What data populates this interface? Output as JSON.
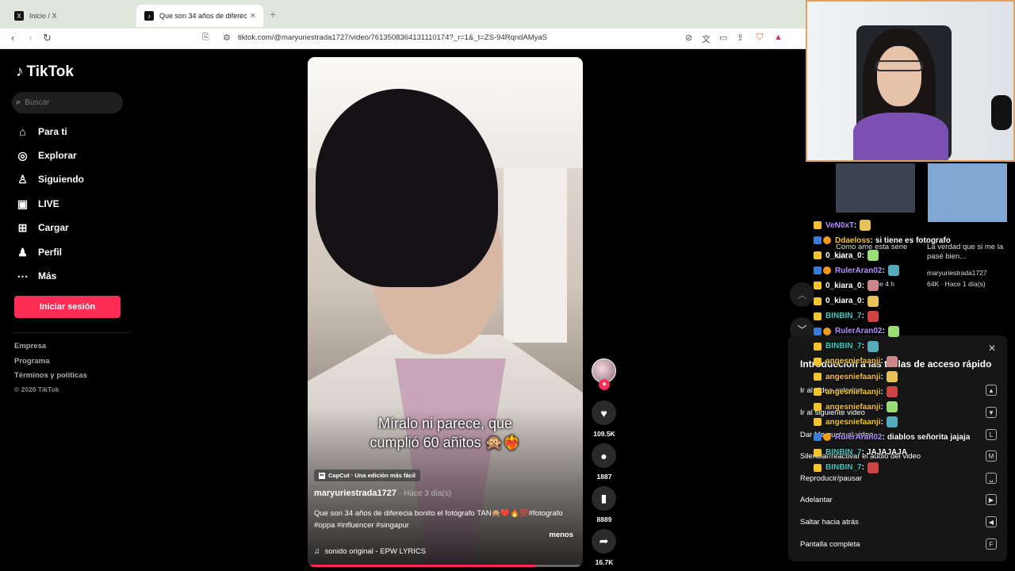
{
  "browser": {
    "tabs": [
      {
        "label": "Inicio / X",
        "favicon": "X"
      },
      {
        "label": "Que son 34 años de diferecia",
        "favicon": "♪",
        "active": true
      }
    ],
    "url": "tiktok.com/@maryuriestrada1727/video/7613508364131110174?_r=1&_t=ZS-94RqndAMyaS"
  },
  "sidebar": {
    "brand": "TikTok",
    "search_placeholder": "Buscar",
    "nav": [
      {
        "label": "Para ti",
        "icon": "home-icon"
      },
      {
        "label": "Explorar",
        "icon": "compass-icon"
      },
      {
        "label": "Siguiendo",
        "icon": "following-icon"
      },
      {
        "label": "LIVE",
        "icon": "live-icon"
      },
      {
        "label": "Cargar",
        "icon": "upload-icon"
      },
      {
        "label": "Perfil",
        "icon": "profile-icon"
      },
      {
        "label": "Más",
        "icon": "more-icon"
      }
    ],
    "login": "Iniciar sesión",
    "footer": [
      "Empresa",
      "Programa",
      "Términos y políticas"
    ],
    "copyright": "© 2026 TikTok"
  },
  "video": {
    "caption_line1": "Míralo ni parece, que",
    "caption_line2": "cumplió 60 añitos 🙊❤️‍🔥",
    "capcut_label": "CapCut · Una edición más fácil",
    "author": "maryuriestrada1727",
    "posted": "· Hace 3 día(s)",
    "description": "Que son 34 años de diferecia bonito el fotógrafo TAN🙊❤️🔥💯#fotografo #oppa #influencer #singapur",
    "less": "menos",
    "sound": "sonido original - EPW LYRICS",
    "progress": 0.83
  },
  "actions": {
    "likes": "109.5K",
    "comments": "1887",
    "saves": "8889",
    "shares": "16.7K"
  },
  "background_thumbs": {
    "left_text": "Como ame esta serie tan...",
    "left_time": "Hace 4 h",
    "right_text": "La verdad que si me la pasé bien...",
    "right_user": "maryuriestrada1727",
    "right_meta": "64K · Hace 1 día(s)"
  },
  "chat": [
    {
      "user": "VeN0xT",
      "msg": "",
      "color": "#b48cff",
      "badges": [
        "crown"
      ]
    },
    {
      "user": "Ddaeloss",
      "msg": "si tiene es fotografo",
      "color": "#f4c430",
      "badges": [
        "blue",
        "orange"
      ]
    },
    {
      "user": "0_kiara_0",
      "msg": "",
      "color": "#ffffff",
      "badges": [
        "crown"
      ]
    },
    {
      "user": "RulerAran02",
      "msg": "",
      "color": "#b48cff",
      "badges": [
        "blue",
        "orange"
      ]
    },
    {
      "user": "0_kiara_0",
      "msg": "",
      "color": "#ffffff",
      "badges": [
        "crown"
      ]
    },
    {
      "user": "0_kiara_0",
      "msg": "",
      "color": "#ffffff",
      "badges": [
        "crown"
      ]
    },
    {
      "user": "BINBIN_7",
      "msg": "",
      "color": "#3ec9c0",
      "badges": [
        "crown"
      ]
    },
    {
      "user": "RulerAran02",
      "msg": "",
      "color": "#b48cff",
      "badges": [
        "blue",
        "orange"
      ]
    },
    {
      "user": "BINBIN_7",
      "msg": "",
      "color": "#3ec9c0",
      "badges": [
        "crown"
      ]
    },
    {
      "user": "angesniefaanji",
      "msg": "",
      "color": "#f4c430",
      "badges": [
        "crown"
      ]
    },
    {
      "user": "angesniefaanji",
      "msg": "",
      "color": "#f4c430",
      "badges": [
        "crown"
      ]
    },
    {
      "user": "angesniefaanji",
      "msg": "",
      "color": "#f4c430",
      "badges": [
        "crown"
      ]
    },
    {
      "user": "angesniefaanji",
      "msg": "",
      "color": "#f4c430",
      "badges": [
        "crown"
      ]
    },
    {
      "user": "angesniefaanji",
      "msg": "",
      "color": "#f4c430",
      "badges": [
        "crown"
      ]
    },
    {
      "user": "RulerAran02",
      "msg": "diablos señorita jajaja",
      "color": "#b48cff",
      "badges": [
        "blue",
        "orange"
      ]
    },
    {
      "user": "BINBIN_7",
      "msg": "JAJAJAJA",
      "color": "#3ec9c0",
      "badges": [
        "crown"
      ]
    },
    {
      "user": "BINBIN_7",
      "msg": "",
      "color": "#3ec9c0",
      "badges": [
        "crown"
      ]
    }
  ],
  "shortcuts": {
    "title": "Introducción a las teclas de acceso rápido",
    "items": [
      {
        "label": "Ir al video anterior",
        "key": "▲"
      },
      {
        "label": "Ir al siguiente video",
        "key": "▼"
      },
      {
        "label": "Dar Me gusta al video",
        "key": "L"
      },
      {
        "label": "Silenciar/reactivar el audio del video",
        "key": "M"
      },
      {
        "label": "Reproducir/pausar",
        "key": "␣"
      },
      {
        "label": "Adelantar",
        "key": "▶"
      },
      {
        "label": "Saltar hacia atrás",
        "key": "◀"
      },
      {
        "label": "Pantalla completa",
        "key": "F"
      }
    ]
  },
  "colors": {
    "accent": "#fe2c55",
    "webcam_border": "#d9a26a"
  }
}
